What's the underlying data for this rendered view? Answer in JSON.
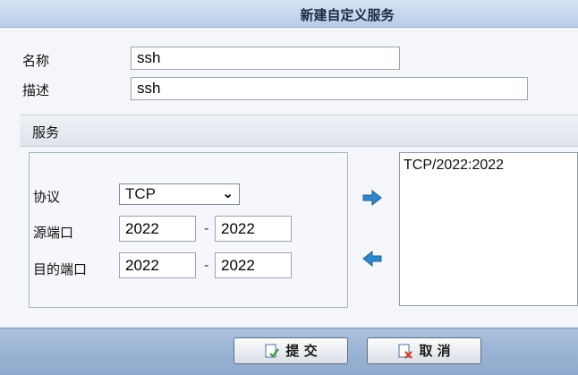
{
  "dialog": {
    "title": "新建自定义服务"
  },
  "form": {
    "name_label": "名称",
    "name_value": "ssh",
    "desc_label": "描述",
    "desc_value": "ssh"
  },
  "service": {
    "section_label": "服务",
    "protocol_label": "协议",
    "protocol_value": "TCP",
    "src_port_label": "源端口",
    "src_port_from": "2022",
    "src_port_to": "2022",
    "dst_port_label": "目的端口",
    "dst_port_from": "2022",
    "dst_port_to": "2022",
    "range_separator": "-",
    "entries": [
      "TCP/2022:2022"
    ]
  },
  "footer": {
    "submit_label": "提 交",
    "cancel_label": "取 消"
  },
  "colors": {
    "accent": "#2f86c9",
    "footer": "#9bb4d6"
  },
  "icons": [
    "arrow-right-icon",
    "arrow-left-icon",
    "submit-check-icon",
    "cancel-x-icon",
    "chevron-down-icon"
  ]
}
